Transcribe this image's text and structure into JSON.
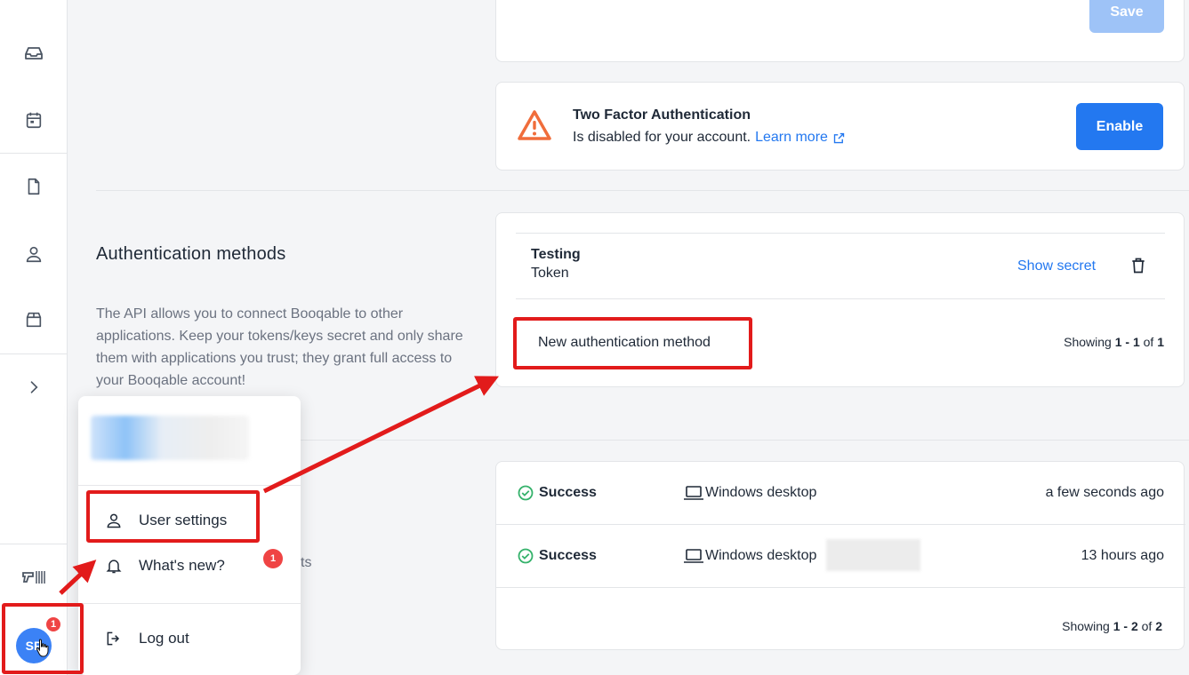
{
  "sidebar": {
    "icons": [
      "inbox-icon",
      "calendar-icon",
      "document-icon",
      "user-icon",
      "box-icon",
      "chevron-right-icon",
      "barcode-scanner-icon"
    ],
    "avatar_initials": "SP",
    "avatar_badge": "1"
  },
  "top_card": {
    "save_label": "Save"
  },
  "two_factor": {
    "title": "Two Factor Authentication",
    "status_text": "Is disabled for your account.",
    "learn_more": "Learn more",
    "enable_label": "Enable"
  },
  "auth_methods": {
    "title": "Authentication methods",
    "description": "The API allows you to connect Booqable to other applications. Keep your tokens/keys secret and only share them with applications you trust; they grant full access to your Booqable account!",
    "token": {
      "name": "Testing",
      "type": "Token",
      "show_secret": "Show secret"
    },
    "new_method_label": "New authentication method",
    "pagination": {
      "prefix": "Showing ",
      "range": "1 - 1",
      "of": " of ",
      "total": "1"
    }
  },
  "sessions": {
    "partial_label": "ts",
    "rows": [
      {
        "status": "Success",
        "device": "Windows desktop",
        "time": "a few seconds ago"
      },
      {
        "status": "Success",
        "device": "Windows desktop",
        "time": "13 hours ago"
      }
    ],
    "pagination": {
      "prefix": "Showing ",
      "range": "1 - 2",
      "of": " of ",
      "total": "2"
    }
  },
  "user_menu": {
    "items": [
      {
        "label": "User settings",
        "icon": "user-icon"
      },
      {
        "label": "What's new?",
        "icon": "bell-icon",
        "badge": "1"
      },
      {
        "label": "Log out",
        "icon": "logout-icon"
      }
    ]
  },
  "colors": {
    "accent": "#2378f0",
    "warning": "#f06d3b",
    "success": "#35b26b",
    "annotation": "#e21b1b"
  }
}
